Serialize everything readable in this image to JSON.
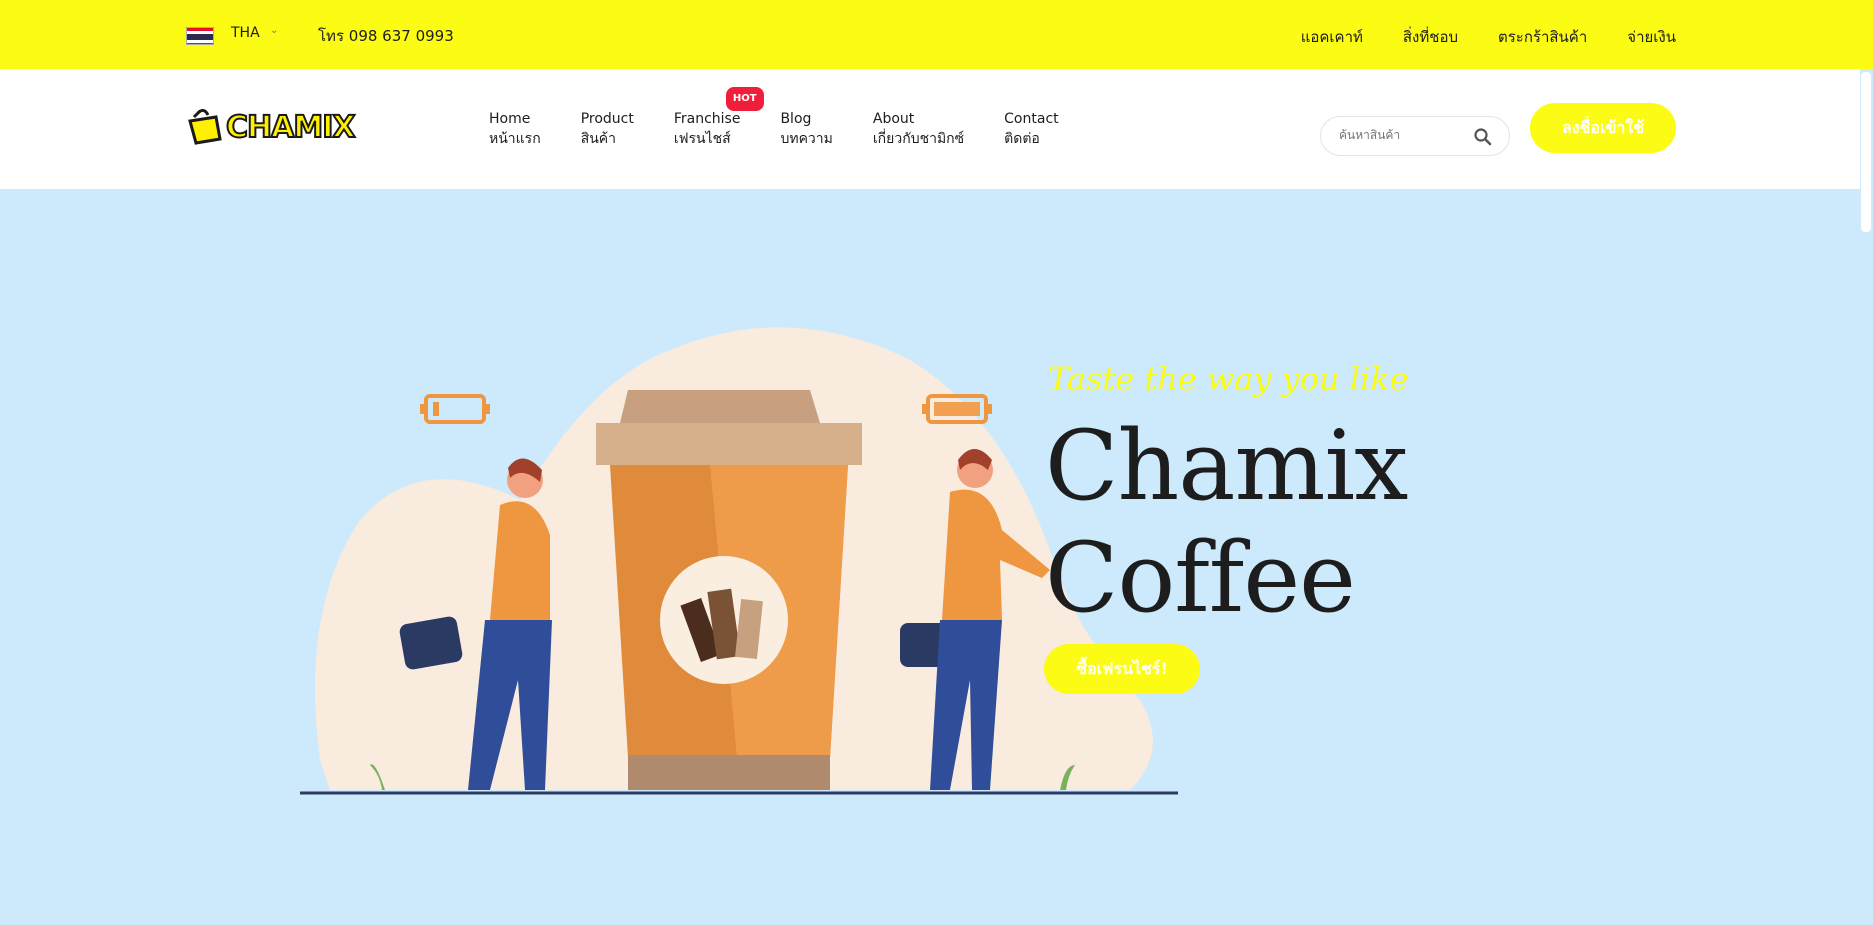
{
  "topbar": {
    "language": "THA",
    "phone": "โทร 098 637 0993",
    "links": [
      "แอคเคาท์",
      "สิ่งที่ชอบ",
      "ตระกร้าสินค้า",
      "จ่ายเงิน"
    ]
  },
  "header": {
    "logo_text": "CHAMIX",
    "nav": [
      {
        "en": "Home",
        "th": "หน้าแรก"
      },
      {
        "en": "Product",
        "th": "สินค้า"
      },
      {
        "en": "Franchise",
        "th": "เฟรนไชส์",
        "badge": "HOT"
      },
      {
        "en": "Blog",
        "th": "บทความ"
      },
      {
        "en": "About",
        "th": "เกี่ยวกับชามิกซ์"
      },
      {
        "en": "Contact",
        "th": "ติดต่อ"
      }
    ],
    "search_placeholder": "ค้นหาสินค้า",
    "login_label": "ลงชื่อเข้าใช้"
  },
  "hero": {
    "tagline": "Taste the way you like",
    "title_line1": "Chamix",
    "title_line2": "Coffee",
    "cta_label": "ซื้อเฟรนไชร์!"
  },
  "colors": {
    "accent_yellow": "#fbfb14",
    "hero_bg": "#cdeafc",
    "badge_red": "#ef1f3b"
  }
}
